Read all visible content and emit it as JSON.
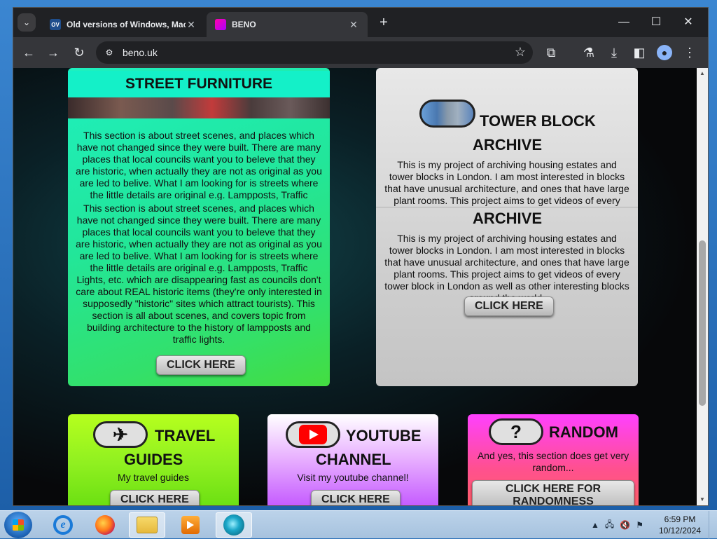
{
  "browser": {
    "tabs": [
      {
        "title": "Old versions of Windows, Mac",
        "favicon": "OV",
        "active": false
      },
      {
        "title": "BENO",
        "favicon": "beno-icon",
        "active": true
      }
    ],
    "url": "beno.uk",
    "new_tab": "+",
    "controls": {
      "minimize": "—",
      "maximize": "☐",
      "close": "✕"
    }
  },
  "page": {
    "street": {
      "heading": "STREET FURNITURE",
      "text": "This section is about street scenes, and places which have not changed since they were built. There are many places that local councils want you to beleve that they are historic, when actually they are not as original as you are led to belive. What I am looking for is streets where the little details are original e.g. Lampposts, Traffic Lights, etc. which are disappearing fast as councils don't care about REAL historic items (they're only interested in supposedly \"historic\" sites which attract tourists). This section is all about scenes, and covers topic from building architecture to the history of lampposts and traffic lights.",
      "button": "CLICK HERE"
    },
    "tower": {
      "heading_line1": "TOWER BLOCK",
      "heading_line2": "ARCHIVE",
      "text": "This is my project of archiving housing estates and tower blocks in London. I am most interested in blocks that have unusual architecture, and ones that have large plant rooms. This project aims to get videos of every tower block in London as well as other interesting blocks around the world.",
      "button": "CLICK HERE"
    },
    "travel": {
      "heading_line1": "TRAVEL",
      "heading_line2": "GUIDES",
      "text": "My travel guides",
      "button": "CLICK HERE"
    },
    "youtube": {
      "heading_line1": "YOUTUBE",
      "heading_line2": "CHANNEL",
      "text": "Visit my youtube channel!",
      "button": "CLICK HERE"
    },
    "random": {
      "heading": "RANDOM",
      "icon": "?",
      "text": "And yes, this section does get very random...",
      "button_line1": "CLICK HERE FOR",
      "button_line2": "RANDOMNESS"
    }
  },
  "taskbar": {
    "time": "6:59 PM",
    "date": "10/12/2024"
  }
}
